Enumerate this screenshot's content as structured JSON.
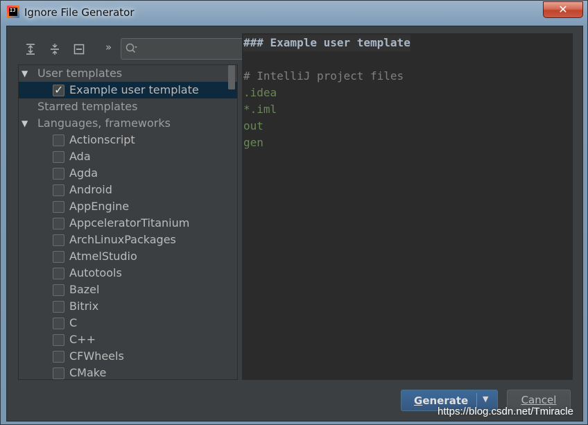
{
  "window": {
    "title": "Ignore File Generator",
    "icon": "intellij-icon",
    "close_label": "✕"
  },
  "toolbar": {
    "expand_all_icon": "expand-all-icon",
    "collapse_all_icon": "collapse-all-icon",
    "collapse_icon": "collapse-icon",
    "more_label": "»",
    "search": {
      "value": "",
      "placeholder": ""
    }
  },
  "tree": {
    "groups": [
      {
        "label": "User templates",
        "expanded": true,
        "items": [
          {
            "label": "Example user template",
            "checked": true,
            "selected": true
          }
        ]
      },
      {
        "label": "Starred templates",
        "expanded": false,
        "items": []
      },
      {
        "label": "Languages, frameworks",
        "expanded": true,
        "items": [
          {
            "label": "Actionscript",
            "checked": false
          },
          {
            "label": "Ada",
            "checked": false
          },
          {
            "label": "Agda",
            "checked": false
          },
          {
            "label": "Android",
            "checked": false
          },
          {
            "label": "AppEngine",
            "checked": false
          },
          {
            "label": "AppceleratorTitanium",
            "checked": false
          },
          {
            "label": "ArchLinuxPackages",
            "checked": false
          },
          {
            "label": "AtmelStudio",
            "checked": false
          },
          {
            "label": "Autotools",
            "checked": false
          },
          {
            "label": "Bazel",
            "checked": false
          },
          {
            "label": "Bitrix",
            "checked": false
          },
          {
            "label": "C",
            "checked": false
          },
          {
            "label": "C++",
            "checked": false
          },
          {
            "label": "CFWheels",
            "checked": false
          },
          {
            "label": "CMake",
            "checked": false
          }
        ]
      }
    ]
  },
  "preview": {
    "heading": "### Example user template",
    "comment": "# IntelliJ project files",
    "entries": [
      ".idea",
      "*.iml",
      "out",
      "gen"
    ]
  },
  "buttons": {
    "generate_label": "Generate",
    "generate_dropdown_icon": "chevron-down-icon",
    "cancel_label": "Cancel"
  },
  "watermark": "https://blog.csdn.net/Tmiracle",
  "colors": {
    "dialog_bg": "#3c3f41",
    "editor_bg": "#2b2b2b",
    "selection": "#0d293e",
    "gitignore_entry": "#6a8759",
    "comment": "#808080",
    "primary_button": "#365880"
  }
}
